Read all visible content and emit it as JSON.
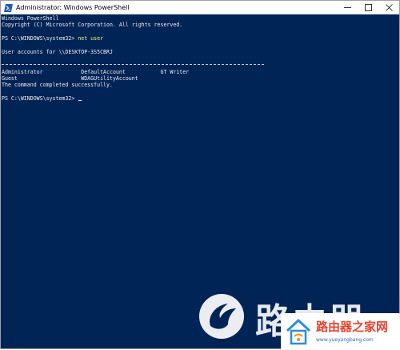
{
  "window": {
    "title": "Administrator: Windows PowerShell",
    "controls": {
      "minimize": "—",
      "maximize": "☐",
      "close": "✕"
    }
  },
  "terminal": {
    "banner_1": "Windows PowerShell",
    "banner_2": "Copyright (C) Microsoft Corporation. All rights reserved.",
    "prompt_1": "PS C:\\WINDOWS\\system32> ",
    "command_1": "net user",
    "output_header": "User accounts for \\\\DESKTOP-3S5CBRJ",
    "accounts_row_1": "Administrator            DefaultAccount           GT Writer",
    "accounts_row_2": "Guest                    WDAGUtilityAccount",
    "completion": "The command completed successfully.",
    "prompt_2": "PS C:\\WINDOWS\\system32> "
  },
  "watermark": {
    "text": "路由器",
    "brand": "路由器之家网",
    "url": "www.yueyangbang.com"
  },
  "colors": {
    "terminal_bg": "#012456",
    "terminal_fg": "#eeedf0",
    "command_fg": "#f5f179"
  }
}
